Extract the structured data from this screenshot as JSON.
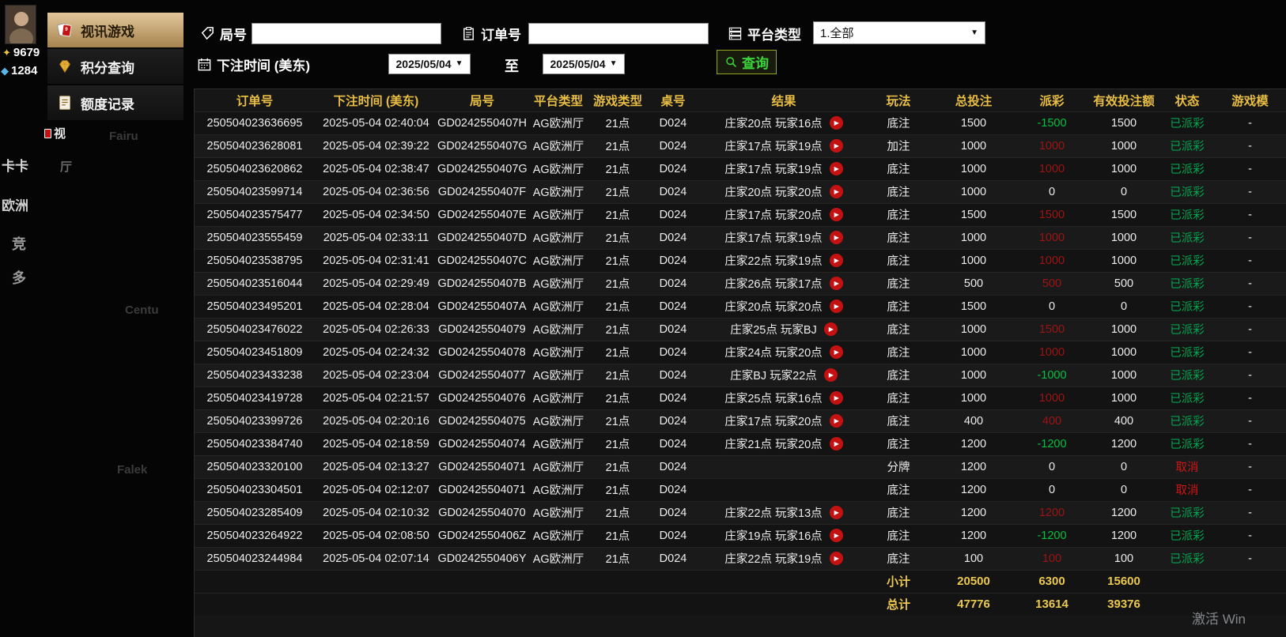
{
  "left_edge": {
    "gold_balance": "9679",
    "blue_balance": "1284",
    "frag_video": "视",
    "frag_kaka": "卡卡",
    "frag_ting": "厅",
    "frag_europe": "欧洲",
    "frag_jing": "竞",
    "frag_duo": "多",
    "faint_fragments": [
      "Fairu",
      "Centu",
      "Falek"
    ]
  },
  "sidebar": {
    "items": [
      {
        "label": "视讯游戏",
        "icon": "cards-icon",
        "active": true
      },
      {
        "label": "积分查询",
        "icon": "diamond-icon",
        "active": false
      },
      {
        "label": "额度记录",
        "icon": "document-icon",
        "active": false
      }
    ]
  },
  "filters": {
    "round": {
      "label": "局号",
      "value": ""
    },
    "order": {
      "label": "订单号",
      "value": ""
    },
    "platform": {
      "label": "平台类型",
      "selected": "1.全部"
    },
    "bet_time": {
      "label": "下注时间 (美东)",
      "from": "2025/05/04",
      "to_label": "至",
      "to": "2025/05/04"
    },
    "search_label": "查询"
  },
  "table": {
    "columns": [
      "订单号",
      "下注时间 (美东)",
      "局号",
      "平台类型",
      "游戏类型",
      "桌号",
      "结果",
      "玩法",
      "总投注",
      "派彩",
      "有效投注额",
      "状态",
      "游戏模"
    ],
    "rows": [
      {
        "order": "250504023636695",
        "time": "2025-05-04 02:40:04",
        "round": "GD0242550407H",
        "platform": "AG欧洲厅",
        "game": "21点",
        "table_no": "D024",
        "result": "庄家20点 玩家16点",
        "has_replay": true,
        "play_type": "底注",
        "total_bet": "1500",
        "payout": "-1500",
        "payout_color": "green",
        "valid_bet": "1500",
        "status": "已派彩",
        "status_color": "green",
        "mode": "-"
      },
      {
        "order": "250504023628081",
        "time": "2025-05-04 02:39:22",
        "round": "GD0242550407G",
        "platform": "AG欧洲厅",
        "game": "21点",
        "table_no": "D024",
        "result": "庄家17点 玩家19点",
        "has_replay": true,
        "play_type": "加注",
        "total_bet": "1000",
        "payout": "1000",
        "payout_color": "red",
        "valid_bet": "1000",
        "status": "已派彩",
        "status_color": "green",
        "mode": "-"
      },
      {
        "order": "250504023620862",
        "time": "2025-05-04 02:38:47",
        "round": "GD0242550407G",
        "platform": "AG欧洲厅",
        "game": "21点",
        "table_no": "D024",
        "result": "庄家17点 玩家19点",
        "has_replay": true,
        "play_type": "底注",
        "total_bet": "1000",
        "payout": "1000",
        "payout_color": "red",
        "valid_bet": "1000",
        "status": "已派彩",
        "status_color": "green",
        "mode": "-"
      },
      {
        "order": "250504023599714",
        "time": "2025-05-04 02:36:56",
        "round": "GD0242550407F",
        "platform": "AG欧洲厅",
        "game": "21点",
        "table_no": "D024",
        "result": "庄家20点 玩家20点",
        "has_replay": true,
        "play_type": "底注",
        "total_bet": "1000",
        "payout": "0",
        "payout_color": "plain",
        "valid_bet": "0",
        "status": "已派彩",
        "status_color": "green",
        "mode": "-"
      },
      {
        "order": "250504023575477",
        "time": "2025-05-04 02:34:50",
        "round": "GD0242550407E",
        "platform": "AG欧洲厅",
        "game": "21点",
        "table_no": "D024",
        "result": "庄家17点 玩家20点",
        "has_replay": true,
        "play_type": "底注",
        "total_bet": "1500",
        "payout": "1500",
        "payout_color": "red",
        "valid_bet": "1500",
        "status": "已派彩",
        "status_color": "green",
        "mode": "-"
      },
      {
        "order": "250504023555459",
        "time": "2025-05-04 02:33:11",
        "round": "GD0242550407D",
        "platform": "AG欧洲厅",
        "game": "21点",
        "table_no": "D024",
        "result": "庄家17点 玩家19点",
        "has_replay": true,
        "play_type": "底注",
        "total_bet": "1000",
        "payout": "1000",
        "payout_color": "red",
        "valid_bet": "1000",
        "status": "已派彩",
        "status_color": "green",
        "mode": "-"
      },
      {
        "order": "250504023538795",
        "time": "2025-05-04 02:31:41",
        "round": "GD0242550407C",
        "platform": "AG欧洲厅",
        "game": "21点",
        "table_no": "D024",
        "result": "庄家22点 玩家19点",
        "has_replay": true,
        "play_type": "底注",
        "total_bet": "1000",
        "payout": "1000",
        "payout_color": "red",
        "valid_bet": "1000",
        "status": "已派彩",
        "status_color": "green",
        "mode": "-"
      },
      {
        "order": "250504023516044",
        "time": "2025-05-04 02:29:49",
        "round": "GD0242550407B",
        "platform": "AG欧洲厅",
        "game": "21点",
        "table_no": "D024",
        "result": "庄家26点 玩家17点",
        "has_replay": true,
        "play_type": "底注",
        "total_bet": "500",
        "payout": "500",
        "payout_color": "red",
        "valid_bet": "500",
        "status": "已派彩",
        "status_color": "green",
        "mode": "-"
      },
      {
        "order": "250504023495201",
        "time": "2025-05-04 02:28:04",
        "round": "GD0242550407A",
        "platform": "AG欧洲厅",
        "game": "21点",
        "table_no": "D024",
        "result": "庄家20点 玩家20点",
        "has_replay": true,
        "play_type": "底注",
        "total_bet": "1500",
        "payout": "0",
        "payout_color": "plain",
        "valid_bet": "0",
        "status": "已派彩",
        "status_color": "green",
        "mode": "-"
      },
      {
        "order": "250504023476022",
        "time": "2025-05-04 02:26:33",
        "round": "GD02425504079",
        "platform": "AG欧洲厅",
        "game": "21点",
        "table_no": "D024",
        "result": "庄家25点 玩家BJ",
        "has_replay": true,
        "play_type": "底注",
        "total_bet": "1000",
        "payout": "1500",
        "payout_color": "red",
        "valid_bet": "1000",
        "status": "已派彩",
        "status_color": "green",
        "mode": "-"
      },
      {
        "order": "250504023451809",
        "time": "2025-05-04 02:24:32",
        "round": "GD02425504078",
        "platform": "AG欧洲厅",
        "game": "21点",
        "table_no": "D024",
        "result": "庄家24点 玩家20点",
        "has_replay": true,
        "play_type": "底注",
        "total_bet": "1000",
        "payout": "1000",
        "payout_color": "red",
        "valid_bet": "1000",
        "status": "已派彩",
        "status_color": "green",
        "mode": "-"
      },
      {
        "order": "250504023433238",
        "time": "2025-05-04 02:23:04",
        "round": "GD02425504077",
        "platform": "AG欧洲厅",
        "game": "21点",
        "table_no": "D024",
        "result": "庄家BJ 玩家22点",
        "has_replay": true,
        "play_type": "底注",
        "total_bet": "1000",
        "payout": "-1000",
        "payout_color": "green",
        "valid_bet": "1000",
        "status": "已派彩",
        "status_color": "green",
        "mode": "-"
      },
      {
        "order": "250504023419728",
        "time": "2025-05-04 02:21:57",
        "round": "GD02425504076",
        "platform": "AG欧洲厅",
        "game": "21点",
        "table_no": "D024",
        "result": "庄家25点 玩家16点",
        "has_replay": true,
        "play_type": "底注",
        "total_bet": "1000",
        "payout": "1000",
        "payout_color": "red",
        "valid_bet": "1000",
        "status": "已派彩",
        "status_color": "green",
        "mode": "-"
      },
      {
        "order": "250504023399726",
        "time": "2025-05-04 02:20:16",
        "round": "GD02425504075",
        "platform": "AG欧洲厅",
        "game": "21点",
        "table_no": "D024",
        "result": "庄家17点 玩家20点",
        "has_replay": true,
        "play_type": "底注",
        "total_bet": "400",
        "payout": "400",
        "payout_color": "red",
        "valid_bet": "400",
        "status": "已派彩",
        "status_color": "green",
        "mode": "-"
      },
      {
        "order": "250504023384740",
        "time": "2025-05-04 02:18:59",
        "round": "GD02425504074",
        "platform": "AG欧洲厅",
        "game": "21点",
        "table_no": "D024",
        "result": "庄家21点 玩家20点",
        "has_replay": true,
        "play_type": "底注",
        "total_bet": "1200",
        "payout": "-1200",
        "payout_color": "green",
        "valid_bet": "1200",
        "status": "已派彩",
        "status_color": "green",
        "mode": "-"
      },
      {
        "order": "250504023320100",
        "time": "2025-05-04 02:13:27",
        "round": "GD02425504071",
        "platform": "AG欧洲厅",
        "game": "21点",
        "table_no": "D024",
        "result": "",
        "has_replay": false,
        "play_type": "分牌",
        "total_bet": "1200",
        "payout": "0",
        "payout_color": "plain",
        "valid_bet": "0",
        "status": "取消",
        "status_color": "red",
        "mode": "-"
      },
      {
        "order": "250504023304501",
        "time": "2025-05-04 02:12:07",
        "round": "GD02425504071",
        "platform": "AG欧洲厅",
        "game": "21点",
        "table_no": "D024",
        "result": "",
        "has_replay": false,
        "play_type": "底注",
        "total_bet": "1200",
        "payout": "0",
        "payout_color": "plain",
        "valid_bet": "0",
        "status": "取消",
        "status_color": "red",
        "mode": "-"
      },
      {
        "order": "250504023285409",
        "time": "2025-05-04 02:10:32",
        "round": "GD02425504070",
        "platform": "AG欧洲厅",
        "game": "21点",
        "table_no": "D024",
        "result": "庄家22点 玩家13点",
        "has_replay": true,
        "play_type": "底注",
        "total_bet": "1200",
        "payout": "1200",
        "payout_color": "red",
        "valid_bet": "1200",
        "status": "已派彩",
        "status_color": "green",
        "mode": "-"
      },
      {
        "order": "250504023264922",
        "time": "2025-05-04 02:08:50",
        "round": "GD0242550406Z",
        "platform": "AG欧洲厅",
        "game": "21点",
        "table_no": "D024",
        "result": "庄家19点 玩家16点",
        "has_replay": true,
        "play_type": "底注",
        "total_bet": "1200",
        "payout": "-1200",
        "payout_color": "green",
        "valid_bet": "1200",
        "status": "已派彩",
        "status_color": "green",
        "mode": "-"
      },
      {
        "order": "250504023244984",
        "time": "2025-05-04 02:07:14",
        "round": "GD0242550406Y",
        "platform": "AG欧洲厅",
        "game": "21点",
        "table_no": "D024",
        "result": "庄家22点 玩家19点",
        "has_replay": true,
        "play_type": "底注",
        "total_bet": "100",
        "payout": "100",
        "payout_color": "red",
        "valid_bet": "100",
        "status": "已派彩",
        "status_color": "green",
        "mode": "-"
      }
    ],
    "subtotal": {
      "label": "小计",
      "total_bet": "20500",
      "payout": "6300",
      "valid_bet": "15600"
    },
    "total": {
      "label": "总计",
      "total_bet": "47776",
      "payout": "13614",
      "valid_bet": "39376"
    }
  },
  "watermark": "激活 Win",
  "colors": {
    "accent_gold": "#e7bd44",
    "win_red": "#9e1414",
    "loss_green": "#00c141",
    "status_paid_green": "#00a651",
    "status_cancel_red": "#cf1616",
    "active_menu_tan": "#c9a369"
  }
}
